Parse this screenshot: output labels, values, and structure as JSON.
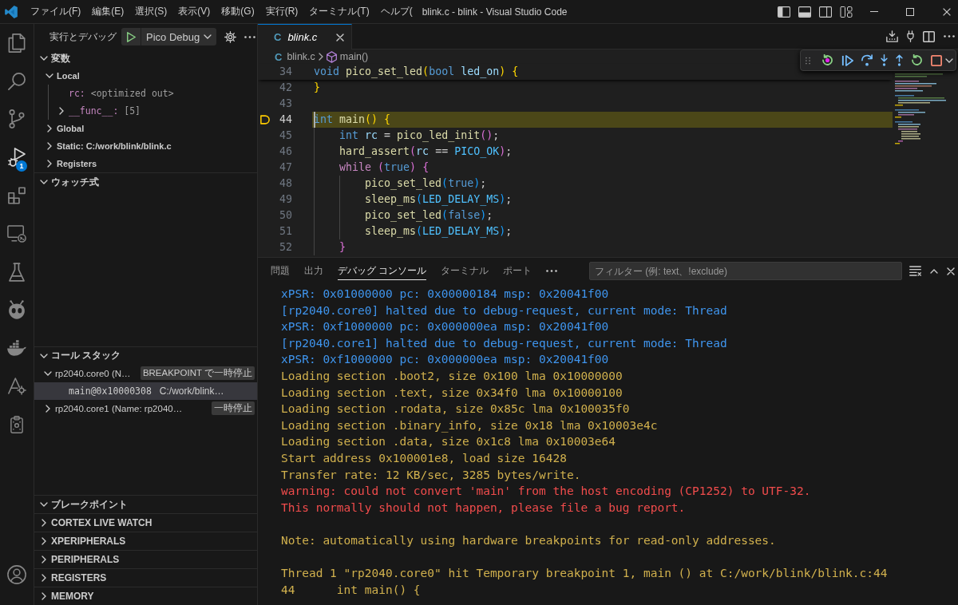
{
  "title_bar": {
    "menus": [
      "ファイル(F)",
      "編集(E)",
      "選択(S)",
      "表示(V)",
      "移動(G)",
      "実行(R)",
      "ターミナル(T)",
      "ヘルプ("
    ],
    "title": "blink.c - blink - Visual Studio Code",
    "layout_toggles": [
      {
        "on": true
      },
      {
        "on": true
      },
      {
        "on": false
      }
    ]
  },
  "activity_bar": {
    "items": [
      {
        "selected": false
      },
      {
        "selected": false
      },
      {
        "selected": false
      },
      {
        "selected": true,
        "badge": "1"
      },
      {
        "selected": false
      },
      {
        "selected": false
      },
      {
        "selected": false
      },
      {
        "selected": false
      },
      {
        "selected": false
      },
      {
        "selected": false
      },
      {
        "selected": false
      }
    ]
  },
  "sidebar": {
    "title": "実行とデバッグ",
    "launch_config": "Pico Debug",
    "sections": [
      {
        "title": "変数",
        "kind": "variables",
        "expanded": true,
        "items": [
          {
            "kind": "scope",
            "label": "Local",
            "expanded": true,
            "children": [
              {
                "kind": "variable",
                "name": "rc:",
                "value": "<optimized out>"
              },
              {
                "kind": "variable",
                "name": "__func__:",
                "value": "[5]",
                "expanded": false
              }
            ]
          },
          {
            "kind": "scope",
            "label": "Global",
            "expanded": false
          },
          {
            "kind": "scope",
            "label": "Static: C:/work/blink/blink.c",
            "expanded": false
          },
          {
            "kind": "scope",
            "label": "Registers",
            "expanded": false
          }
        ]
      },
      {
        "title": "ウォッチ式",
        "kind": "watch",
        "expanded": true
      },
      {
        "title": "コール スタック",
        "kind": "call_stack",
        "expanded": true,
        "threads": [
          {
            "label": "rp2040.core0 (N…",
            "badge": "BREAKPOINT で一時停止",
            "expanded": true,
            "selected": false,
            "frames": [
              {
                "function": "main@0x10000308",
                "file": "C:/work/blink…",
                "selected": true
              }
            ]
          },
          {
            "label": "rp2040.core1 (Name: rp2040…",
            "badge": "一時停止",
            "expanded": false,
            "selected": false
          }
        ]
      },
      {
        "title": "ブレークポイント",
        "kind": "breakpoints",
        "expanded": true
      },
      {
        "title": "CORTEX LIVE WATCH",
        "kind": "view",
        "expanded": false
      },
      {
        "title": "XPERIPHERALS",
        "kind": "view",
        "expanded": false
      },
      {
        "title": "PERIPHERALS",
        "kind": "view",
        "expanded": false
      },
      {
        "title": "REGISTERS",
        "kind": "view",
        "expanded": false
      },
      {
        "title": "MEMORY",
        "kind": "view",
        "expanded": false
      }
    ]
  },
  "editor": {
    "tabs": [
      {
        "file_icon": "C",
        "label": "blink.c",
        "selected": true,
        "preview": true
      }
    ],
    "breadcrumbs": [
      {
        "kind": "file",
        "icon": "C",
        "label": "blink.c"
      },
      {
        "kind": "symbol",
        "label": "main()"
      }
    ],
    "sticky_lines": [
      {
        "number": "34",
        "tokens": [
          {
            "text": "void",
            "kind": "keyword"
          },
          {
            "text": " pico_set_led",
            "kind": "function"
          },
          {
            "text": "(",
            "kind": "paren1"
          },
          {
            "text": "bool",
            "kind": "keyword"
          },
          {
            "text": " led_on",
            "kind": "variable"
          },
          {
            "text": ")",
            "kind": "paren1"
          },
          {
            "text": " {",
            "kind": "paren1"
          }
        ]
      }
    ],
    "lines": [
      {
        "number": "42",
        "current": false,
        "tokens": [
          {
            "text": "}",
            "kind": "paren1"
          }
        ]
      },
      {
        "number": "43",
        "current": false
      },
      {
        "number": "44",
        "current": true,
        "tokens": [
          {
            "text": "int",
            "kind": "keyword"
          },
          {
            "text": " main",
            "kind": "function"
          },
          {
            "text": "()",
            "kind": "paren1"
          },
          {
            "text": " {",
            "kind": "paren1"
          }
        ]
      },
      {
        "number": "45",
        "current": false,
        "tokens": [
          {
            "text": "    int",
            "kind": "keyword"
          },
          {
            "text": " rc",
            "kind": "variable"
          },
          {
            "text": " =",
            "kind": "plain"
          },
          {
            "text": " pico_led_init",
            "kind": "function"
          },
          {
            "text": "()",
            "kind": "paren2"
          },
          {
            "text": ";",
            "kind": "plain"
          }
        ]
      },
      {
        "number": "46",
        "current": false,
        "tokens": [
          {
            "text": "    hard_assert",
            "kind": "function"
          },
          {
            "text": "(",
            "kind": "paren2"
          },
          {
            "text": "rc",
            "kind": "variable"
          },
          {
            "text": " ==",
            "kind": "plain"
          },
          {
            "text": " PICO_OK",
            "kind": "macro"
          },
          {
            "text": ")",
            "kind": "paren2"
          },
          {
            "text": ";",
            "kind": "plain"
          }
        ]
      },
      {
        "number": "47",
        "current": false,
        "tokens": [
          {
            "text": "    while",
            "kind": "control"
          },
          {
            "text": " (",
            "kind": "paren2"
          },
          {
            "text": "true",
            "kind": "keyword"
          },
          {
            "text": ")",
            "kind": "paren2"
          },
          {
            "text": " {",
            "kind": "paren2"
          }
        ]
      },
      {
        "number": "48",
        "current": false,
        "tokens": [
          {
            "text": "        pico_set_led",
            "kind": "function"
          },
          {
            "text": "(",
            "kind": "paren3"
          },
          {
            "text": "true",
            "kind": "keyword"
          },
          {
            "text": ")",
            "kind": "paren3"
          },
          {
            "text": ";",
            "kind": "plain"
          }
        ]
      },
      {
        "number": "49",
        "current": false,
        "tokens": [
          {
            "text": "        sleep_ms",
            "kind": "function"
          },
          {
            "text": "(",
            "kind": "paren3"
          },
          {
            "text": "LED_DELAY_MS",
            "kind": "macro"
          },
          {
            "text": ")",
            "kind": "paren3"
          },
          {
            "text": ";",
            "kind": "plain"
          }
        ]
      },
      {
        "number": "50",
        "current": false,
        "tokens": [
          {
            "text": "        pico_set_led",
            "kind": "function"
          },
          {
            "text": "(",
            "kind": "paren3"
          },
          {
            "text": "false",
            "kind": "keyword"
          },
          {
            "text": ")",
            "kind": "paren3"
          },
          {
            "text": ";",
            "kind": "plain"
          }
        ]
      },
      {
        "number": "51",
        "current": false,
        "tokens": [
          {
            "text": "        sleep_ms",
            "kind": "function"
          },
          {
            "text": "(",
            "kind": "paren3"
          },
          {
            "text": "LED_DELAY_MS",
            "kind": "macro"
          },
          {
            "text": ")",
            "kind": "paren3"
          },
          {
            "text": ";",
            "kind": "plain"
          }
        ]
      },
      {
        "number": "52",
        "current": false,
        "tokens": [
          {
            "text": "    }",
            "kind": "paren2"
          }
        ]
      }
    ]
  },
  "panel": {
    "tabs": [
      {
        "label": "問題",
        "selected": false
      },
      {
        "label": "出力",
        "selected": false
      },
      {
        "label": "デバッグ コンソール",
        "selected": true
      },
      {
        "label": "ターミナル",
        "selected": false
      },
      {
        "label": "ポート",
        "selected": false
      }
    ],
    "filter": {
      "placeholder": "フィルター (例: text、!exclude)"
    },
    "console": [
      {
        "kind": "info",
        "text": "xPSR: 0x01000000 pc: 0x00000184 msp: 0x20041f00"
      },
      {
        "kind": "info",
        "text": "[rp2040.core0] halted due to debug-request, current mode: Thread"
      },
      {
        "kind": "info",
        "text": "xPSR: 0xf1000000 pc: 0x000000ea msp: 0x20041f00"
      },
      {
        "kind": "info",
        "text": "[rp2040.core1] halted due to debug-request, current mode: Thread"
      },
      {
        "kind": "info",
        "text": "xPSR: 0xf1000000 pc: 0x000000ea msp: 0x20041f00"
      },
      {
        "kind": "output",
        "text": "Loading section .boot2, size 0x100 lma 0x10000000"
      },
      {
        "kind": "output",
        "text": "Loading section .text, size 0x34f0 lma 0x10000100"
      },
      {
        "kind": "output",
        "text": "Loading section .rodata, size 0x85c lma 0x100035f0"
      },
      {
        "kind": "output",
        "text": "Loading section .binary_info, size 0x18 lma 0x10003e4c"
      },
      {
        "kind": "output",
        "text": "Loading section .data, size 0x1c8 lma 0x10003e64"
      },
      {
        "kind": "output",
        "text": "Start address 0x100001e8, load size 16428"
      },
      {
        "kind": "output",
        "text": "Transfer rate: 12 KB/sec, 3285 bytes/write."
      },
      {
        "kind": "error",
        "text": "warning: could not convert 'main' from the host encoding (CP1252) to UTF-32."
      },
      {
        "kind": "error",
        "text": "This normally should not happen, please file a bug report."
      },
      {
        "kind": "blank"
      },
      {
        "kind": "output",
        "text": "Note: automatically using hardware breakpoints for read-only addresses."
      },
      {
        "kind": "blank"
      },
      {
        "kind": "output",
        "text": "Thread 1 \"rp2040.core0\" hit Temporary breakpoint 1, main () at C:/work/blink/blink.c:44"
      },
      {
        "kind": "output",
        "text": "44\tint main() {"
      }
    ]
  }
}
